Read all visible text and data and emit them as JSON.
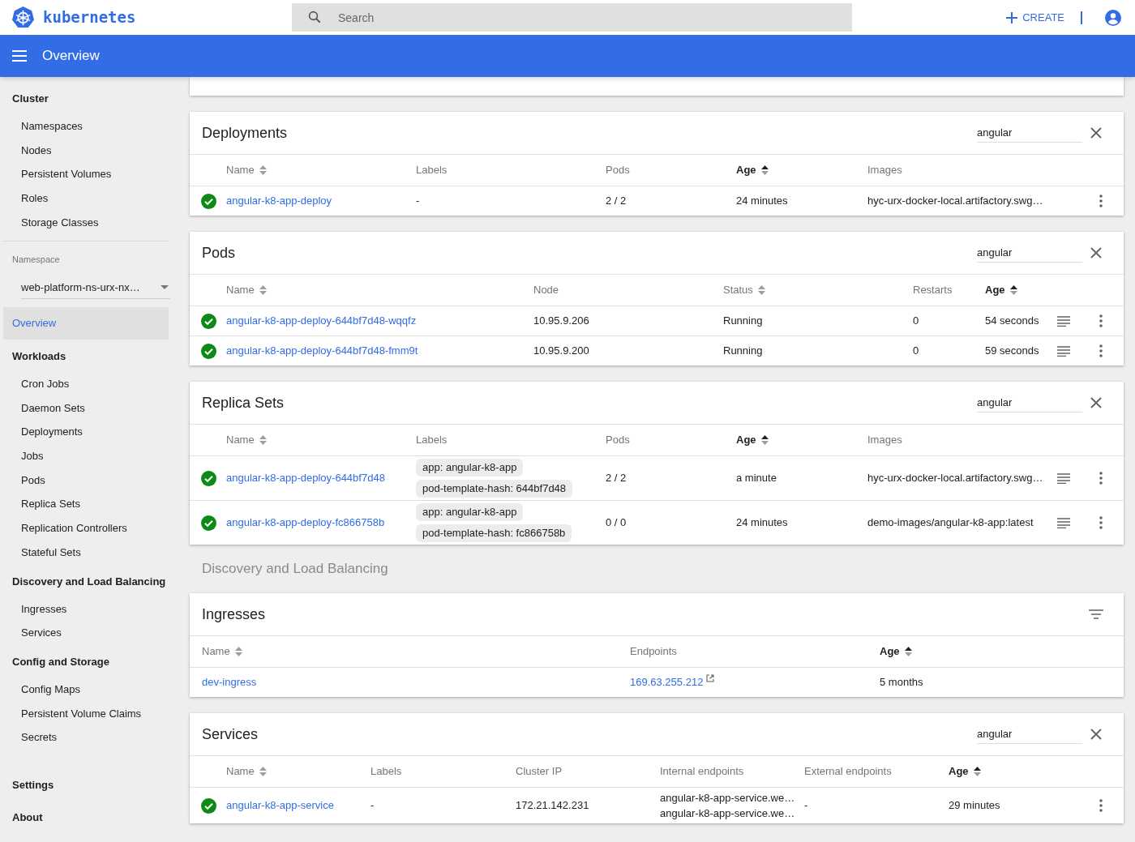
{
  "header": {
    "logo_text": "kubernetes",
    "search_placeholder": "Search",
    "create_label": "CREATE"
  },
  "toolbar": {
    "title": "Overview"
  },
  "sidebar": [
    {
      "kind": "section",
      "title": "Cluster",
      "items": [
        {
          "label": "Namespaces",
          "selected": false
        },
        {
          "label": "Nodes",
          "selected": false
        },
        {
          "label": "Persistent Volumes",
          "selected": false
        },
        {
          "label": "Roles",
          "selected": false
        },
        {
          "label": "Storage Classes",
          "selected": false
        }
      ]
    },
    {
      "kind": "namespace",
      "label": "Namespace",
      "value": "web-platform-ns-urx-nx…"
    },
    {
      "kind": "link",
      "label": "Overview",
      "selected": true
    },
    {
      "kind": "section",
      "title": "Workloads",
      "items": [
        {
          "label": "Cron Jobs",
          "selected": false
        },
        {
          "label": "Daemon Sets",
          "selected": false
        },
        {
          "label": "Deployments",
          "selected": false
        },
        {
          "label": "Jobs",
          "selected": false
        },
        {
          "label": "Pods",
          "selected": false
        },
        {
          "label": "Replica Sets",
          "selected": false
        },
        {
          "label": "Replication Controllers",
          "selected": false
        },
        {
          "label": "Stateful Sets",
          "selected": false
        }
      ]
    },
    {
      "kind": "section",
      "title": "Discovery and Load Balancing",
      "items": [
        {
          "label": "Ingresses",
          "selected": false
        },
        {
          "label": "Services",
          "selected": false
        }
      ]
    },
    {
      "kind": "section",
      "title": "Config and Storage",
      "items": [
        {
          "label": "Config Maps",
          "selected": false
        },
        {
          "label": "Persistent Volume Claims",
          "selected": false
        },
        {
          "label": "Secrets",
          "selected": false
        }
      ]
    },
    {
      "kind": "section",
      "title": "Settings"
    },
    {
      "kind": "section",
      "title": "About"
    }
  ],
  "panels": [
    {
      "kind": "card",
      "title": "Deployments",
      "filter": {
        "kind": "field",
        "value": "angular"
      },
      "columns": [
        {
          "label": "Name",
          "sortable": true,
          "sorted": false
        },
        {
          "label": "Labels",
          "sortable": false,
          "sorted": false
        },
        {
          "label": "Pods",
          "sortable": false,
          "sorted": false
        },
        {
          "label": "Age",
          "sortable": true,
          "sorted": true
        },
        {
          "label": "Images",
          "sortable": false,
          "sorted": false
        }
      ],
      "rows": [
        {
          "healthy": true,
          "cells": [
            {
              "kind": "link",
              "text": "angular-k8-app-deploy"
            },
            {
              "kind": "text",
              "text": "-"
            },
            {
              "kind": "text",
              "text": "2 / 2"
            },
            {
              "kind": "text",
              "text": "24 minutes"
            },
            {
              "kind": "text",
              "text": "hyc-urx-docker-local.artifactory.swg…"
            }
          ],
          "logs": false,
          "menu": true
        }
      ]
    },
    {
      "kind": "card",
      "title": "Pods",
      "filter": {
        "kind": "field",
        "value": "angular"
      },
      "columns": [
        {
          "label": "Name",
          "sortable": true,
          "sorted": false
        },
        {
          "label": "Node",
          "sortable": false,
          "sorted": false
        },
        {
          "label": "Status",
          "sortable": true,
          "sorted": false
        },
        {
          "label": "Restarts",
          "sortable": false,
          "sorted": false
        },
        {
          "label": "Age",
          "sortable": true,
          "sorted": true
        }
      ],
      "rows": [
        {
          "healthy": true,
          "cells": [
            {
              "kind": "link",
              "text": "angular-k8-app-deploy-644bf7d48-wqqfz"
            },
            {
              "kind": "text",
              "text": "10.95.9.206"
            },
            {
              "kind": "text",
              "text": "Running"
            },
            {
              "kind": "text",
              "text": "0"
            },
            {
              "kind": "text",
              "text": "54 seconds"
            }
          ],
          "logs": true,
          "menu": true
        },
        {
          "healthy": true,
          "cells": [
            {
              "kind": "link",
              "text": "angular-k8-app-deploy-644bf7d48-fmm9t"
            },
            {
              "kind": "text",
              "text": "10.95.9.200"
            },
            {
              "kind": "text",
              "text": "Running"
            },
            {
              "kind": "text",
              "text": "0"
            },
            {
              "kind": "text",
              "text": "59 seconds"
            }
          ],
          "logs": true,
          "menu": true
        }
      ]
    },
    {
      "kind": "card",
      "title": "Replica Sets",
      "filter": {
        "kind": "field",
        "value": "angular"
      },
      "columns": [
        {
          "label": "Name",
          "sortable": true,
          "sorted": false
        },
        {
          "label": "Labels",
          "sortable": false,
          "sorted": false
        },
        {
          "label": "Pods",
          "sortable": false,
          "sorted": false
        },
        {
          "label": "Age",
          "sortable": true,
          "sorted": true
        },
        {
          "label": "Images",
          "sortable": false,
          "sorted": false
        }
      ],
      "rows": [
        {
          "healthy": true,
          "cells": [
            {
              "kind": "link",
              "text": "angular-k8-app-deploy-644bf7d48"
            },
            {
              "kind": "labels",
              "labels": [
                "app: angular-k8-app",
                "pod-template-hash: 644bf7d48"
              ]
            },
            {
              "kind": "text",
              "text": "2 / 2"
            },
            {
              "kind": "text",
              "text": "a minute"
            },
            {
              "kind": "text",
              "text": "hyc-urx-docker-local.artifactory.swg…"
            }
          ],
          "logs": true,
          "menu": true
        },
        {
          "healthy": true,
          "cells": [
            {
              "kind": "link",
              "text": "angular-k8-app-deploy-fc866758b"
            },
            {
              "kind": "labels",
              "labels": [
                "app: angular-k8-app",
                "pod-template-hash: fc866758b"
              ]
            },
            {
              "kind": "text",
              "text": "0 / 0"
            },
            {
              "kind": "text",
              "text": "24 minutes"
            },
            {
              "kind": "text",
              "text": "demo-images/angular-k8-app:latest"
            }
          ],
          "logs": true,
          "menu": true
        }
      ]
    },
    {
      "kind": "heading",
      "title": "Discovery and Load Balancing"
    },
    {
      "kind": "card",
      "title": "Ingresses",
      "filter": {
        "kind": "icon"
      },
      "columns": [
        {
          "label": "Name",
          "sortable": true,
          "sorted": false
        },
        {
          "label": "Endpoints",
          "sortable": false,
          "sorted": false
        },
        {
          "label": "Age",
          "sortable": true,
          "sorted": true
        }
      ],
      "rows": [
        {
          "cells": [
            {
              "kind": "link",
              "text": "dev-ingress"
            },
            {
              "kind": "endpoint",
              "text": "169.63.255.212"
            },
            {
              "kind": "text",
              "text": "5 months"
            }
          ]
        }
      ]
    },
    {
      "kind": "card",
      "title": "Services",
      "filter": {
        "kind": "field",
        "value": "angular"
      },
      "columns": [
        {
          "label": "Name",
          "sortable": true,
          "sorted": false
        },
        {
          "label": "Labels",
          "sortable": false,
          "sorted": false
        },
        {
          "label": "Cluster IP",
          "sortable": false,
          "sorted": false
        },
        {
          "label": "Internal endpoints",
          "sortable": false,
          "sorted": false
        },
        {
          "label": "External endpoints",
          "sortable": false,
          "sorted": false
        },
        {
          "label": "Age",
          "sortable": true,
          "sorted": true
        }
      ],
      "rows": [
        {
          "healthy": true,
          "cells": [
            {
              "kind": "link",
              "text": "angular-k8-app-service"
            },
            {
              "kind": "text",
              "text": "-"
            },
            {
              "kind": "text",
              "text": "172.21.142.231"
            },
            {
              "kind": "lines",
              "lines": [
                "angular-k8-app-service.we…",
                "angular-k8-app-service.we…"
              ]
            },
            {
              "kind": "text",
              "text": "-"
            },
            {
              "kind": "text",
              "text": "29 minutes"
            }
          ],
          "logs": false,
          "menu": true
        }
      ]
    }
  ]
}
